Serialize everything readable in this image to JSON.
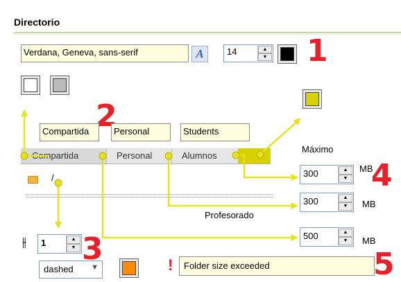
{
  "section_title": "Directorio",
  "font": {
    "family": "Verdana, Geneva, sans-serif",
    "size": "14"
  },
  "user_labels": {
    "shared": "Compartida",
    "personal": "Personal",
    "students": "Students"
  },
  "tabs": [
    "Compartida",
    "Personal",
    "Alumnos"
  ],
  "quota": {
    "max_label": "Máximo",
    "teachers_label": "Profesorado",
    "unit": "MB",
    "max_value": "300",
    "teachers_value": "300",
    "shared_value": "500"
  },
  "tree": {
    "root": "/"
  },
  "border": {
    "width": "1",
    "style": "dashed"
  },
  "alert": {
    "icon": "!",
    "message": "Folder size exceeded"
  },
  "markers": [
    "1",
    "2",
    "3",
    "4",
    "5"
  ],
  "colors": {
    "text": "#000000",
    "background": "#ffffff",
    "border_box": "#bbbbbb",
    "tab_bg": "#d8d100",
    "alert_bg": "#ff8c00",
    "annotation": "#e8202a",
    "arrow": "#e7e21f"
  }
}
